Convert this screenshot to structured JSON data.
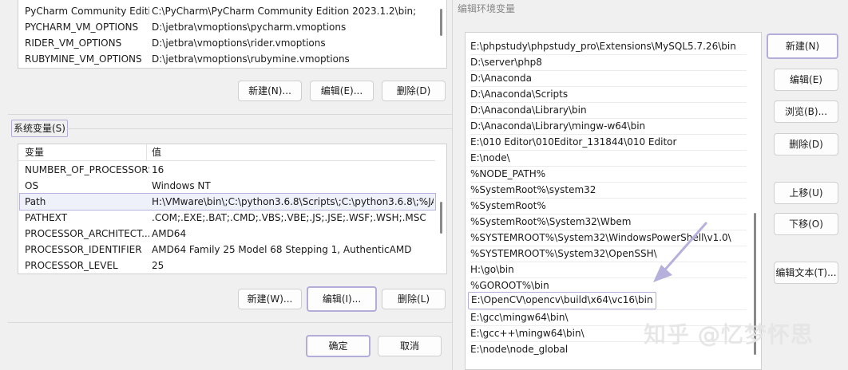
{
  "left": {
    "user_vars": {
      "rows": [
        {
          "name": "PyCharm Community Editi...",
          "value": "C:\\PyCharm\\PyCharm Community Edition 2023.1.2\\bin;"
        },
        {
          "name": "PYCHARM_VM_OPTIONS",
          "value": "D:\\jetbra\\vmoptions\\pycharm.vmoptions"
        },
        {
          "name": "RIDER_VM_OPTIONS",
          "value": "D:\\jetbra\\vmoptions\\rider.vmoptions"
        },
        {
          "name": "RUBYMINE_VM_OPTIONS",
          "value": "D:\\jetbra\\vmoptions\\rubymine.vmoptions"
        }
      ],
      "buttons": {
        "new": "新建(N)...",
        "edit": "编辑(E)...",
        "delete": "删除(D)"
      }
    },
    "system_group_label": "系统变量(S)",
    "system_vars": {
      "headers": {
        "name": "变量",
        "value": "值"
      },
      "rows": [
        {
          "name": "NUMBER_OF_PROCESSORS",
          "value": "16"
        },
        {
          "name": "OS",
          "value": "Windows NT"
        },
        {
          "name": "Path",
          "value": "H:\\VMware\\bin\\;C:\\python3.6.8\\Scripts\\;C:\\python3.6.8\\;%JAV..."
        },
        {
          "name": "PATHEXT",
          "value": ".COM;.EXE;.BAT;.CMD;.VBS;.VBE;.JS;.JSE;.WSF;.WSH;.MSC"
        },
        {
          "name": "PROCESSOR_ARCHITECT...",
          "value": "AMD64"
        },
        {
          "name": "PROCESSOR_IDENTIFIER",
          "value": "AMD64 Family 25 Model 68 Stepping 1, AuthenticAMD"
        },
        {
          "name": "PROCESSOR_LEVEL",
          "value": "25"
        }
      ],
      "buttons": {
        "new": "新建(W)...",
        "edit": "编辑(I)...",
        "delete": "删除(L)"
      }
    },
    "dialog_buttons": {
      "ok": "确定",
      "cancel": "取消"
    }
  },
  "right": {
    "title": "编辑环境变量",
    "paths": [
      "E:\\phpstudy\\phpstudy_pro\\Extensions\\MySQL5.7.26\\bin",
      "D:\\server\\php8",
      "D:\\Anaconda",
      "D:\\Anaconda\\Scripts",
      "D:\\Anaconda\\Library\\bin",
      "D:\\Anaconda\\Library\\mingw-w64\\bin",
      "E:\\010 Editor\\010Editor_131844\\010 Editor",
      "E:\\node\\",
      "%NODE_PATH%",
      "%SystemRoot%\\system32",
      "%SystemRoot%",
      "%SystemRoot%\\System32\\Wbem",
      "%SYSTEMROOT%\\System32\\WindowsPowerShell\\v1.0\\",
      "%SYSTEMROOT%\\System32\\OpenSSH\\",
      "H:\\go\\bin",
      "%GOROOT%\\bin",
      "E:\\OpenCV\\opencv\\build\\x64\\vc16\\bin",
      "E:\\gcc\\mingw64\\bin\\",
      "E:\\gcc++\\mingw64\\bin\\",
      "E:\\node\\node_global"
    ],
    "buttons": {
      "new": "新建(N)",
      "edit": "编辑(E)",
      "browse": "浏览(B)...",
      "delete": "删除(D)",
      "move_up": "上移(U)",
      "move_down": "下移(O)",
      "edit_text": "编辑文本(T)..."
    }
  },
  "watermark": "知乎 @忆梦怀思",
  "colors": {
    "highlight": "#b3add9",
    "arrow": "#b6b1dc"
  }
}
